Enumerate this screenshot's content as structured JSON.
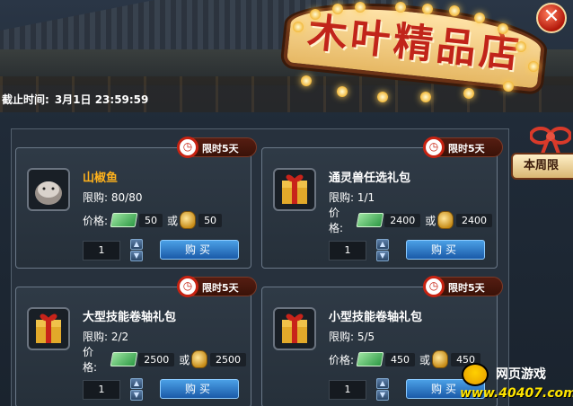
{
  "shop": {
    "title": "木叶精品店",
    "deadline_label": "截止时间:",
    "deadline_value": "3月1日 23:59:59",
    "weekly_tab": "本周限",
    "close_icon_glyph": "✕"
  },
  "common": {
    "badge": "限时5天",
    "limit_label": "限购:",
    "price_label": "价格:",
    "or": "或",
    "buy": "购买",
    "up_glyph": "▲",
    "down_glyph": "▼"
  },
  "items": [
    {
      "name": "山椒鱼",
      "name_color": "gold",
      "icon": "salamander-icon",
      "limit": "80/80",
      "cash_price": "50",
      "coin_price": "50",
      "quantity": "1"
    },
    {
      "name": "通灵兽任选礼包",
      "name_color": "white",
      "icon": "gift-box-icon",
      "limit": "1/1",
      "cash_price": "2400",
      "coin_price": "2400",
      "quantity": "1"
    },
    {
      "name": "大型技能卷轴礼包",
      "name_color": "white",
      "icon": "gift-box-icon",
      "limit": "2/2",
      "cash_price": "2500",
      "coin_price": "2500",
      "quantity": "1"
    },
    {
      "name": "小型技能卷轴礼包",
      "name_color": "white",
      "icon": "gift-box-icon",
      "limit": "5/5",
      "cash_price": "450",
      "coin_price": "450",
      "quantity": "1"
    }
  ],
  "watermark": {
    "top": "网页游戏",
    "bottom": "www.40407.com"
  },
  "colors": {
    "accent_gold": "#ffb21c",
    "buy_button": "#2a73c4",
    "badge_red": "#c82312"
  }
}
